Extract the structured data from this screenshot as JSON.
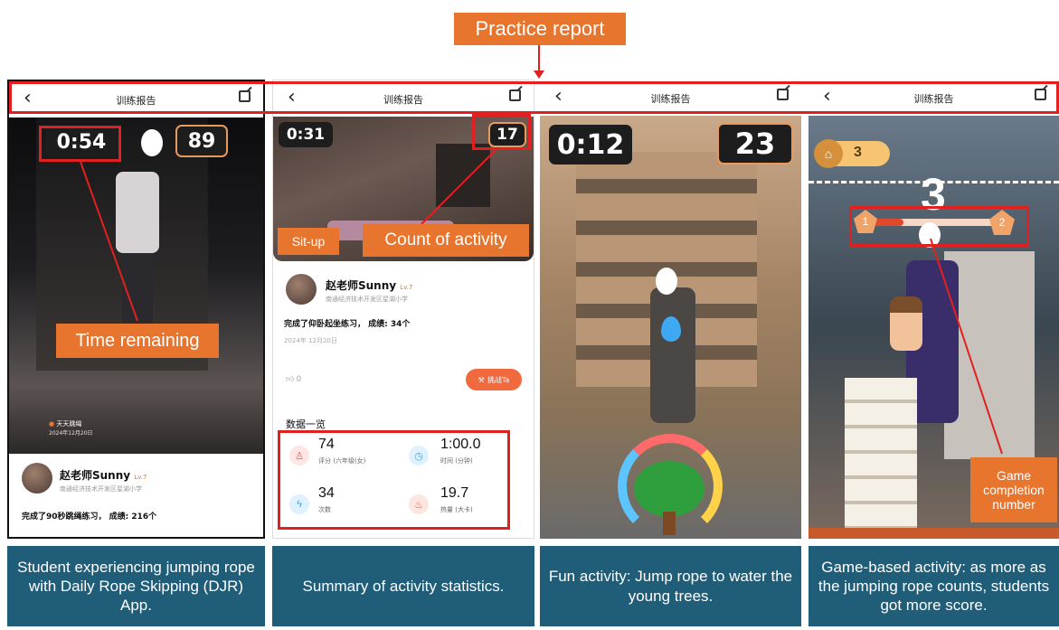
{
  "header_callout": "Practice report",
  "screen_title": "训练报告",
  "callouts": {
    "situp": "Sit-up",
    "count": "Count of activity",
    "time": "Time remaining",
    "game": "Game completion number"
  },
  "panel1": {
    "timer": "0:54",
    "count": "89",
    "watermark_brand": "天天跳绳",
    "watermark_date": "2024年12月20日",
    "user_name": "赵老师Sunny",
    "level": "Lv.7",
    "school": "南通经济技术开发区星湖小学",
    "result": "完成了90秒跳绳练习， 成绩: 216个"
  },
  "panel2": {
    "timer": "0:31",
    "count": "17",
    "user_name": "赵老师Sunny",
    "level": "Lv.7",
    "school": "南通经济技术开发区星湖小学",
    "result": "完成了仰卧起坐练习， 成绩: 34个",
    "date": "2024年 12月20日",
    "likes": "0",
    "challenge_label": "挑战Ta",
    "section_title": "数据一览",
    "stats": [
      {
        "value": "74",
        "label": "评分 (六年级(女)",
        "icon": "score-icon",
        "color": "#e5605a"
      },
      {
        "value": "1:00.0",
        "label": "时间 (分钟)",
        "icon": "stopwatch-icon",
        "color": "#3aa7e8"
      },
      {
        "value": "34",
        "label": "次数",
        "icon": "lightning-icon",
        "color": "#3aa7e8"
      },
      {
        "value": "19.7",
        "label": "热量 (大卡)",
        "icon": "flame-icon",
        "color": "#e85a3c"
      }
    ]
  },
  "panel3": {
    "timer": "0:12",
    "count": "23"
  },
  "panel4": {
    "coins": "3",
    "big_number": "3",
    "left_marker": "1",
    "right_marker": "2"
  },
  "captions": [
    "Student experiencing jumping rope with Daily Rope Skipping (DJR) App.",
    "Summary of activity statistics.",
    "Fun activity: Jump rope to water the young trees.",
    "Game-based activity: as more as the jumping rope counts, students got more score."
  ]
}
